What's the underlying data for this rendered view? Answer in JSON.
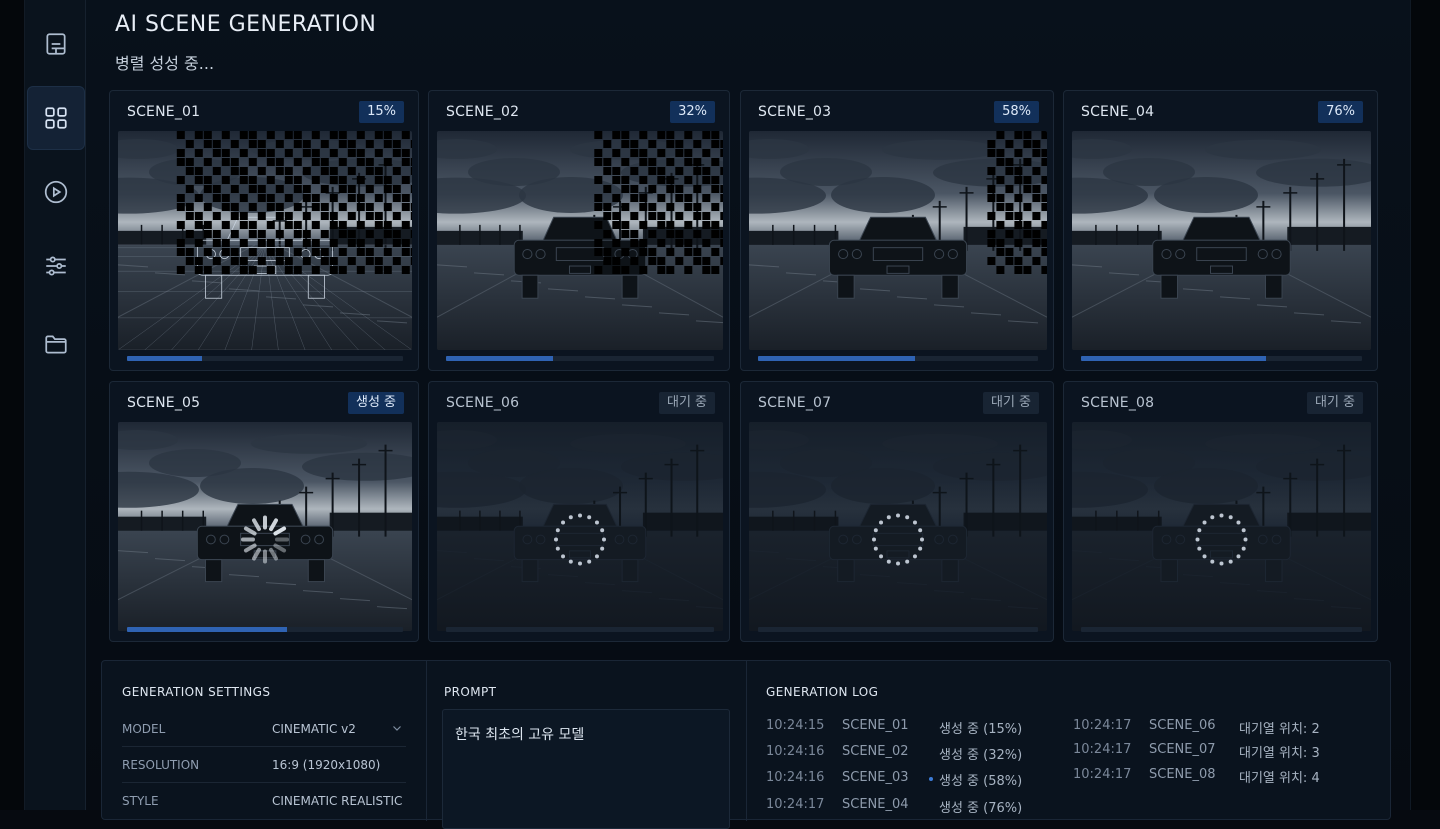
{
  "page": {
    "title": "AI SCENE GENERATION",
    "subtitle": "병렬 성성 중..."
  },
  "sidebar": {
    "items": [
      {
        "name": "document",
        "icon": "document-icon",
        "active": false
      },
      {
        "name": "grid",
        "icon": "grid-icon",
        "active": true
      },
      {
        "name": "play",
        "icon": "play-icon",
        "active": false
      },
      {
        "name": "sliders",
        "icon": "sliders-icon",
        "active": false
      },
      {
        "name": "folder",
        "icon": "folder-icon",
        "active": false
      }
    ]
  },
  "scenes": [
    {
      "label": "SCENE_01",
      "badge": "15%",
      "progress": 0.27,
      "state": "wireframe"
    },
    {
      "label": "SCENE_02",
      "badge": "32%",
      "progress": 0.4,
      "state": "partial"
    },
    {
      "label": "SCENE_03",
      "badge": "58%",
      "progress": 0.56,
      "state": "partial"
    },
    {
      "label": "SCENE_04",
      "badge": "76%",
      "progress": 0.66,
      "state": "partial"
    },
    {
      "label": "SCENE_05",
      "badge": "생성 중",
      "progress": 0.58,
      "state": "generating"
    },
    {
      "label": "SCENE_06",
      "badge": "대기 중",
      "progress": 0,
      "state": "waiting"
    },
    {
      "label": "SCENE_07",
      "badge": "대기 중",
      "progress": 0,
      "state": "waiting"
    },
    {
      "label": "SCENE_08",
      "badge": "대기 중",
      "progress": 0,
      "state": "waiting"
    }
  ],
  "settings": {
    "title": "GENERATION SETTINGS",
    "rows": [
      {
        "key": "MODEL",
        "value": "CINEMATIC v2",
        "dropdown": true
      },
      {
        "key": "RESOLUTION",
        "value": "16:9 (1920x1080)"
      },
      {
        "key": "STYLE",
        "value": "CINEMATIC REALISTIC"
      }
    ]
  },
  "prompt": {
    "title": "PROMPT",
    "text": "한국 최초의 고유 모델"
  },
  "log": {
    "title": "GENERATION LOG",
    "left": [
      {
        "time": "10:24:15",
        "scene": "SCENE_01",
        "status": "생성 중 (15%)"
      },
      {
        "time": "10:24:16",
        "scene": "SCENE_02",
        "status": "생성 중 (32%)"
      },
      {
        "time": "10:24:16",
        "scene": "SCENE_03",
        "status": "생성 중 (58%)"
      },
      {
        "time": "10:24:17",
        "scene": "SCENE_04",
        "status": "생성 중 (76%)"
      }
    ],
    "right": [
      {
        "time": "10:24:17",
        "scene": "SCENE_06",
        "status": "대기열 위치: 2"
      },
      {
        "time": "10:24:17",
        "scene": "SCENE_07",
        "status": "대기열 위치: 3"
      },
      {
        "time": "10:24:17",
        "scene": "SCENE_08",
        "status": "대기열 위치: 4"
      }
    ]
  },
  "colors": {
    "accent": "#2f63b3",
    "background": "#060b12",
    "card": "#0b1420"
  }
}
